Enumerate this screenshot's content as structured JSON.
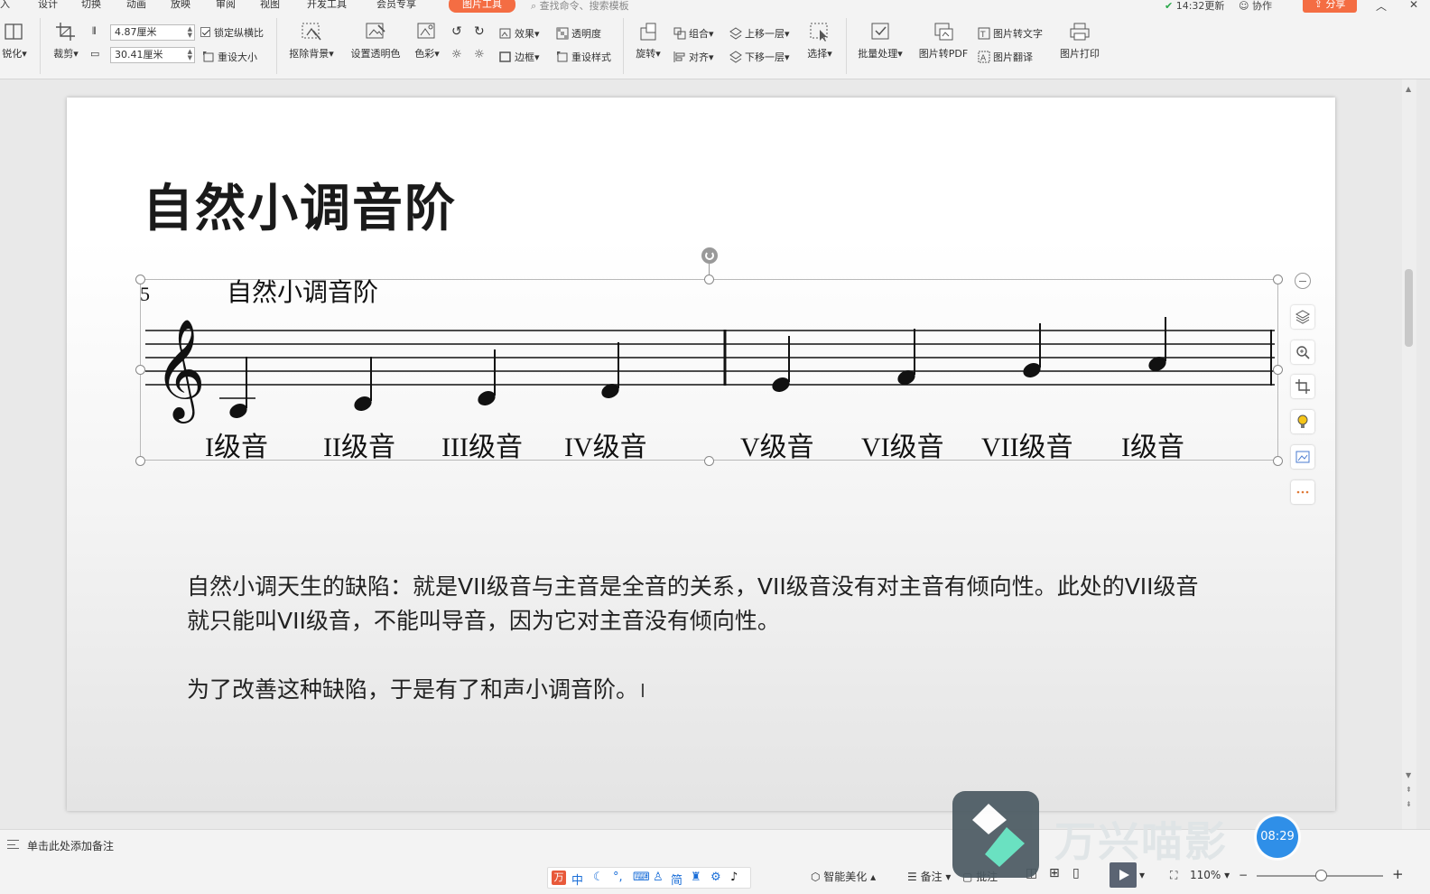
{
  "menubar": {
    "items": [
      "入",
      "设计",
      "切换",
      "动画",
      "放映",
      "审阅",
      "视图",
      "开发工具",
      "会员专享"
    ],
    "active_tab": "图片工具",
    "search_placeholder": "查找命令、搜索模板",
    "time_status": "14:32更新",
    "collab": "协作",
    "share": "分享"
  },
  "ribbon": {
    "sharpen": "锐化",
    "crop": "裁剪",
    "height_value": "4.87厘米",
    "width_value": "30.41厘米",
    "lock_ratio": "锁定纵横比",
    "reset_size": "重设大小",
    "remove_bg": "抠除背景",
    "set_transparent": "设置透明色",
    "color": "色彩",
    "effects": "效果",
    "transparency": "透明度",
    "border": "边框",
    "reset_style": "重设样式",
    "rotate": "旋转",
    "group": "组合",
    "align": "对齐",
    "bring_forward": "上移一层",
    "send_backward": "下移一层",
    "select": "选择",
    "batch": "批量处理",
    "img_to_pdf": "图片转PDF",
    "img_to_text": "图片转文字",
    "img_translate": "图片翻译",
    "img_print": "图片打印"
  },
  "slide": {
    "title": "自然小调音阶",
    "paragraph1_line1": "自然小调天生的缺陷：就是VII级音与主音是全音的关系，VII级音没有对主音有倾向性。此处的VII级音",
    "paragraph1_line2": "就只能叫VII级音，不能叫导音，因为它对主音没有倾向性。",
    "paragraph2": "为了改善这种缺陷，于是有了和声小调音阶。"
  },
  "score": {
    "measure_number": "5",
    "caption": "自然小调音阶",
    "degrees": [
      "I级音",
      "II级音",
      "III级音",
      "IV级音",
      "V级音",
      "VI级音",
      "VII级音",
      "I级音"
    ]
  },
  "notes_bar": {
    "placeholder": "单击此处添加备注"
  },
  "statusbar": {
    "ime_chars": [
      "中",
      "简"
    ],
    "smart_beautify": "智能美化",
    "notes": "备注",
    "comments": "批注",
    "zoom": "110%"
  },
  "watermark": {
    "brand": "万兴喵影",
    "timer": "08:29"
  }
}
